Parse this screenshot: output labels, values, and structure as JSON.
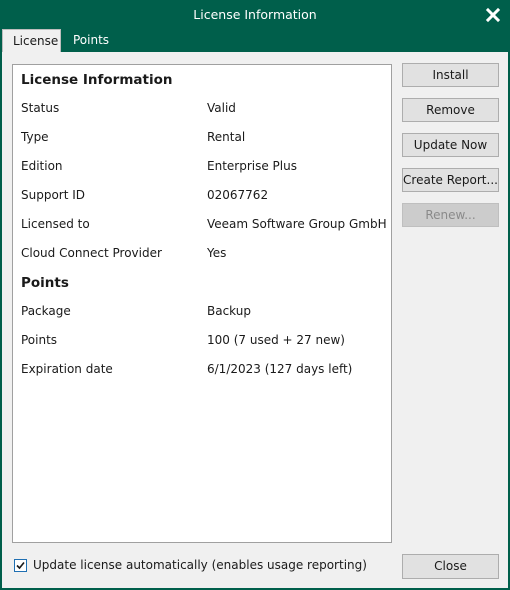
{
  "window": {
    "title": "License Information",
    "close_icon": "close-icon"
  },
  "tabs": [
    {
      "label": "License",
      "active": true
    },
    {
      "label": "Points",
      "active": false
    }
  ],
  "license_section": {
    "title": "License Information",
    "rows": [
      {
        "label": "Status",
        "value": "Valid"
      },
      {
        "label": "Type",
        "value": "Rental"
      },
      {
        "label": "Edition",
        "value": "Enterprise Plus"
      },
      {
        "label": "Support ID",
        "value": "02067762"
      },
      {
        "label": "Licensed to",
        "value": "Veeam Software Group GmbH"
      },
      {
        "label": "Cloud Connect Provider",
        "value": "Yes"
      }
    ]
  },
  "points_section": {
    "title": "Points",
    "rows": [
      {
        "label": "Package",
        "value": "Backup"
      },
      {
        "label": "Points",
        "value": "100 (7 used + 27 new)"
      },
      {
        "label": "Expiration date",
        "value": "6/1/2023 (127 days left)"
      }
    ]
  },
  "buttons": {
    "install": "Install",
    "remove": "Remove",
    "update_now": "Update Now",
    "create_report": "Create Report...",
    "renew": "Renew...",
    "close": "Close"
  },
  "auto_update": {
    "label": "Update license automatically (enables usage reporting)",
    "checked": true
  }
}
